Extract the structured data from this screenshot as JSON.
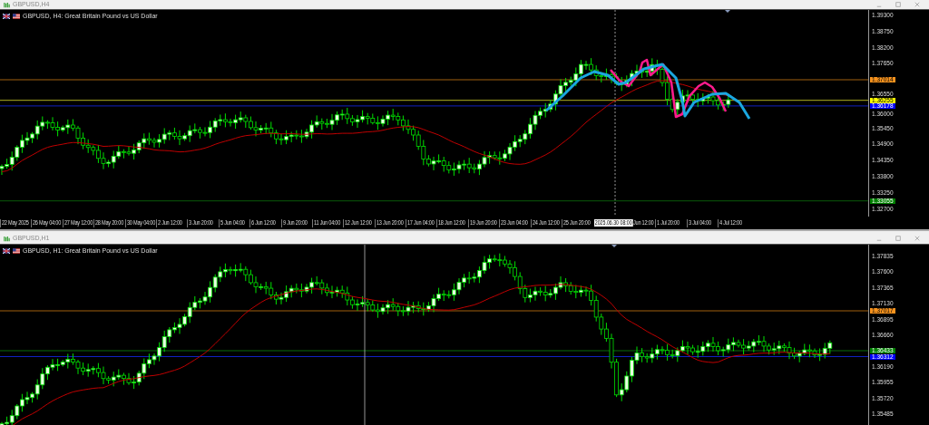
{
  "windows": [
    {
      "title": "GBPUSD,H4",
      "header": "GBPUSD, H4:  Great Britain Pound vs US Dollar",
      "price_labels": [
        "1.39300",
        "1.38750",
        "1.38200",
        "1.37650",
        "1.36550",
        "1.36000",
        "1.35450",
        "1.34900",
        "1.34350",
        "1.33800",
        "1.33250",
        "1.32700"
      ],
      "badges": [
        {
          "text": "1.37014",
          "color": "#f7931e"
        },
        {
          "text": "1.36255",
          "color": "#ffff00"
        },
        {
          "text": "1.36178",
          "color": "#0000ff"
        },
        {
          "text": "1.33055",
          "color": "#008000"
        }
      ],
      "time_labels": [
        "22 May 2025",
        "26 May 04:00",
        "27 May 12:00",
        "28 May 20:00",
        "30 May 04:00",
        "2 Jun 12:00",
        "3 Jun 20:00",
        "5 Jun 04:00",
        "6 Jun 12:00",
        "9 Jun 20:00",
        "11 Jun 04:00",
        "12 Jun 12:00",
        "13 Jun 20:00",
        "17 Jun 04:00",
        "18 Jun 12:00",
        "19 Jun 20:00",
        "23 Jun 04:00",
        "24 Jun 12:00",
        "25 Jun 20:00",
        "Jun 12:00",
        "1 Jul 20:00",
        "3 Jul 04:00",
        "4 Jul 12:00"
      ],
      "crosshair_label": "2025.06.30 08:00"
    },
    {
      "title": "GBPUSD,H1",
      "header": "GBPUSD, H1:  Great Britain Pound vs US Dollar",
      "price_labels": [
        "1.37835",
        "1.37600",
        "1.37365",
        "1.37130",
        "1.36895",
        "1.36660",
        "1.36190",
        "1.35955",
        "1.35720",
        "1.35485"
      ],
      "badges": [
        {
          "text": "1.37017",
          "color": "#f7931e"
        },
        {
          "text": "1.36433",
          "color": "#008000"
        },
        {
          "text": "1.36312",
          "color": "#0000ff"
        }
      ]
    }
  ]
}
